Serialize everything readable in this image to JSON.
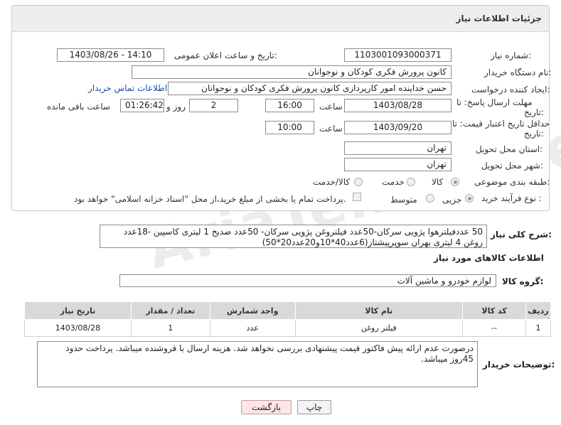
{
  "panel": {
    "title": "جزئیات اطلاعات نیاز"
  },
  "need_number": {
    "label": "شماره نیاز:",
    "value": "1103001093000371"
  },
  "announce": {
    "label": "تاریخ و ساعت اعلان عمومی:",
    "value": "1403/08/26 - 14:10"
  },
  "buyer": {
    "label": "نام دستگاه خریدار:",
    "value": "کانون پرورش فکری کودکان و نوجوانان"
  },
  "creator": {
    "label": "ایجاد کننده درخواست:",
    "value": "حسن خداینده امور کارپردازی  کانون پرورش فکری کودکان و نوجوانان",
    "contact_link": "اطلاعات تماس خریدار"
  },
  "deadline": {
    "label_line1": "مهلت ارسال پاسخ: تا",
    "label_line2": "تاریخ:",
    "date": "1403/08/28",
    "time_label": "ساعت",
    "time": "16:00",
    "days": "2",
    "days_label": "روز و",
    "remaining": "01:26:42",
    "remaining_label": "ساعت باقی مانده"
  },
  "price_validity": {
    "label_line1": "حداقل تاریخ اعتبار قیمت: تا",
    "label_line2": "تاریخ:",
    "date": "1403/09/20",
    "time_label": "ساعت",
    "time": "10:00"
  },
  "province": {
    "label": "استان محل تحویل:",
    "value": "تهران"
  },
  "city": {
    "label": "شهر محل تحویل:",
    "value": "تهران"
  },
  "category": {
    "label": "طبقه بندی موضوعی:",
    "options": [
      "کالا",
      "خدمت",
      "کالا/خدمت"
    ],
    "selected": "کالا"
  },
  "process": {
    "label": "نوع فرآیند خرید :",
    "options": [
      "جزیی",
      "متوسط"
    ],
    "selected": "جزیی",
    "checkbox_text": "پرداخت تمام یا بخشی از مبلغ خرید،از محل \"اسناد خزانه اسلامی\" خواهد بود."
  },
  "description": {
    "label": "شرح کلی نیاز:",
    "value": "50 عددفیلترهوا پژویی سرکان-50عدد فیلتروغن پژویی سرکان- 50عدد ضدیخ 1 لیتری کاسپین -18عدد روغن 4 لیتری بهران سوپرپیشتاز(6عدد40*10و20عدد20*50)"
  },
  "goods_info": {
    "title": "اطلاعات کالاهای مورد نیاز"
  },
  "goods_group": {
    "label": "گروه کالا:",
    "value": "لوازم خودرو و ماشین آلات"
  },
  "items_table": {
    "headers": [
      "ردیف",
      "کد کالا",
      "نام کالا",
      "واحد شمارش",
      "تعداد / مقدار",
      "تاریخ نیاز"
    ],
    "rows": [
      [
        "1",
        "--",
        "فیلتر روغن",
        "عدد",
        "1",
        "1403/08/28"
      ]
    ]
  },
  "buyer_notes": {
    "label": "توضیحات خریدار:",
    "value": "درصورت عدم ارائه پیش فاکتور قیمت پیشنهادی بررسی نخواهد شد. هزینه ارسال با فروشنده میباشد. پرداخت حدود 45روز میباشد."
  },
  "buttons": {
    "print": "چاپ",
    "back": "بازگشت"
  },
  "watermark": "AriaTender.net"
}
